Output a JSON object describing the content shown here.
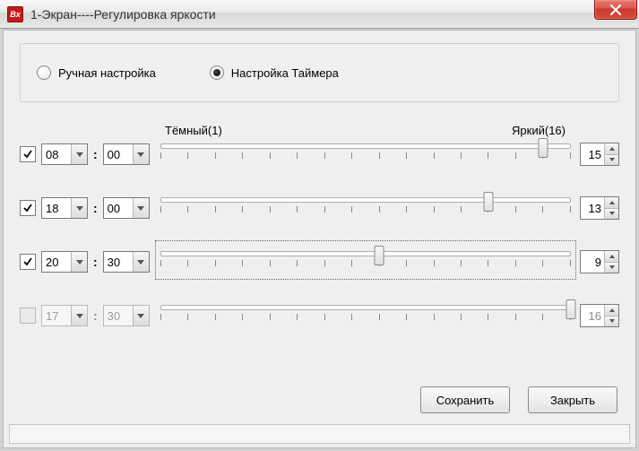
{
  "window": {
    "title": "1-Экран----Регулировка яркости",
    "icon_label": "Bx"
  },
  "mode": {
    "manual_label": "Ручная настройка",
    "timer_label": "Настройка Таймера",
    "selected": "timer"
  },
  "scale": {
    "dark_label": "Тёмный(1)",
    "bright_label": "Яркий(16)",
    "min": 1,
    "max": 16
  },
  "rows": [
    {
      "enabled": true,
      "hour": "08",
      "minute": "00",
      "value": 15,
      "focused": false
    },
    {
      "enabled": true,
      "hour": "18",
      "minute": "00",
      "value": 13,
      "focused": false
    },
    {
      "enabled": true,
      "hour": "20",
      "minute": "30",
      "value": 9,
      "focused": true
    },
    {
      "enabled": false,
      "hour": "17",
      "minute": "30",
      "value": 16,
      "focused": false
    }
  ],
  "buttons": {
    "save": "Сохранить",
    "close": "Закрыть"
  }
}
